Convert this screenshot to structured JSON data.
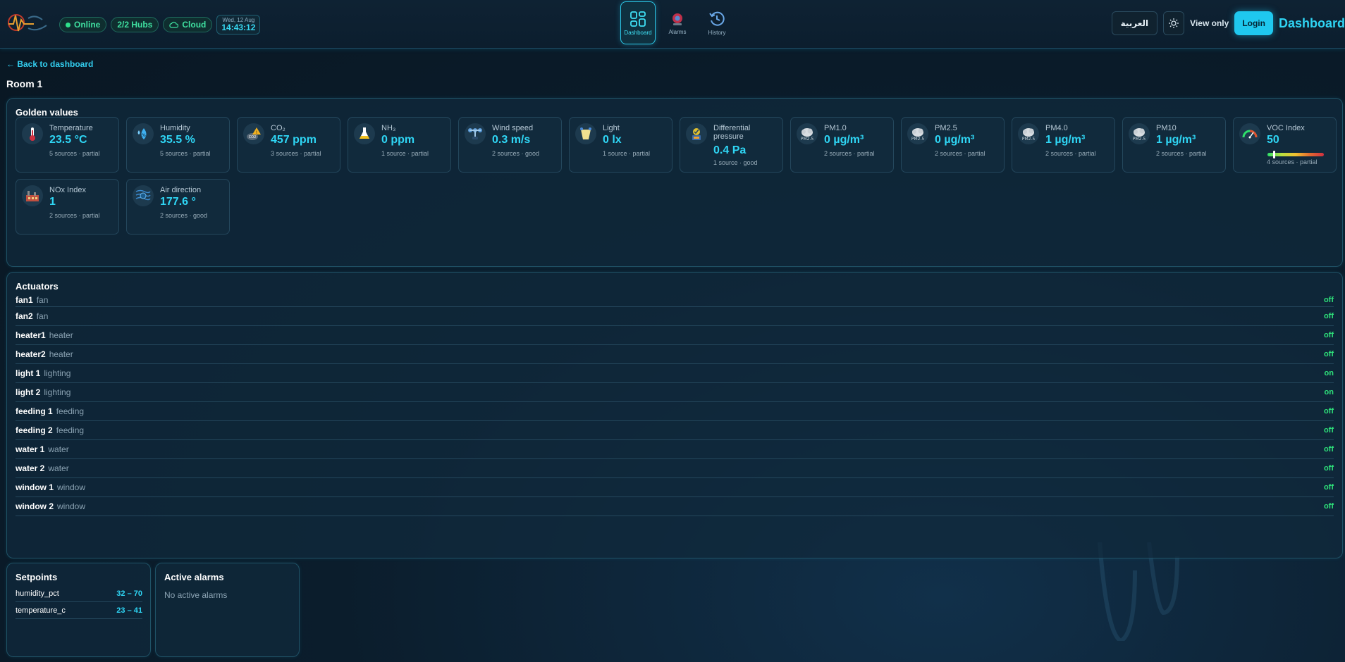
{
  "header": {
    "status": {
      "online": "Online",
      "hubs": "2/2 Hubs",
      "cloud": "Cloud",
      "date": "Wed, 12 Aug",
      "time": "14:43:12"
    },
    "nav": [
      {
        "label": "Dashboard",
        "icon": "dashboard-icon",
        "active": true
      },
      {
        "label": "Alarms",
        "icon": "alarm-bell-icon",
        "active": false
      },
      {
        "label": "History",
        "icon": "history-icon",
        "active": false
      }
    ],
    "language": "العربية",
    "view_only": "View only",
    "login": "Login",
    "title": "Dashboard"
  },
  "page": {
    "back": "← Back to dashboard",
    "room": "Room 1"
  },
  "golden": {
    "title": "Golden values",
    "cards": [
      {
        "label": "Temperature",
        "value": "23.5 °C",
        "sources": "5 sources · partial",
        "icon": "thermometer-icon"
      },
      {
        "label": "Humidity",
        "value": "35.5 %",
        "sources": "5 sources · partial",
        "icon": "humidity-drops-icon"
      },
      {
        "label": "CO₂",
        "value": "457 ppm",
        "sources": "3 sources · partial",
        "icon": "co2-warning-icon"
      },
      {
        "label": "NH₃",
        "value": "0 ppm",
        "sources": "1 source · partial",
        "icon": "nh3-flask-icon"
      },
      {
        "label": "Wind speed",
        "value": "0.3 m/s",
        "sources": "2 sources · good",
        "icon": "wind-speed-icon"
      },
      {
        "label": "Light",
        "value": "0 lx",
        "sources": "1 source · partial",
        "icon": "light-cup-icon"
      },
      {
        "label": "Differential pressure",
        "value": "0.4 Pa",
        "sources": "1 source · good",
        "icon": "pressure-gauge-icon"
      },
      {
        "label": "PM1.0",
        "value": "0 µg/m³",
        "sources": "2 sources · partial",
        "icon": "pm-cloud-icon"
      },
      {
        "label": "PM2.5",
        "value": "0 µg/m³",
        "sources": "2 sources · partial",
        "icon": "pm-cloud-icon"
      },
      {
        "label": "PM4.0",
        "value": "1 µg/m³",
        "sources": "2 sources · partial",
        "icon": "pm-cloud-icon"
      },
      {
        "label": "PM10",
        "value": "1 µg/m³",
        "sources": "2 sources · partial",
        "icon": "pm-cloud-icon"
      },
      {
        "label": "VOC Index",
        "value": "50",
        "sources": "4 sources · partial",
        "icon": "voc-gauge-icon",
        "level": 0.1
      },
      {
        "label": "NOx Index",
        "value": "1",
        "sources": "2 sources · partial",
        "icon": "nox-factory-icon"
      },
      {
        "label": "Air direction",
        "value": "177.6 °",
        "sources": "2 sources · good",
        "icon": "air-direction-icon"
      }
    ]
  },
  "actuators": {
    "title": "Actuators",
    "items": [
      {
        "name": "fan1",
        "type": "fan",
        "state": "off"
      },
      {
        "name": "fan2",
        "type": "fan",
        "state": "off"
      },
      {
        "name": "heater1",
        "type": "heater",
        "state": "off"
      },
      {
        "name": "heater2",
        "type": "heater",
        "state": "off"
      },
      {
        "name": "light 1",
        "type": "lighting",
        "state": "on"
      },
      {
        "name": "light 2",
        "type": "lighting",
        "state": "on"
      },
      {
        "name": "feeding 1",
        "type": "feeding",
        "state": "off"
      },
      {
        "name": "feeding 2",
        "type": "feeding",
        "state": "off"
      },
      {
        "name": "water 1",
        "type": "water",
        "state": "off"
      },
      {
        "name": "water 2",
        "type": "water",
        "state": "off"
      },
      {
        "name": "window 1",
        "type": "window",
        "state": "off"
      },
      {
        "name": "window 2",
        "type": "window",
        "state": "off"
      }
    ]
  },
  "setpoints": {
    "title": "Setpoints",
    "items": [
      {
        "key": "humidity_pct",
        "range": "32 – 70"
      },
      {
        "key": "temperature_c",
        "range": "23 – 41"
      }
    ]
  },
  "alarms": {
    "title": "Active alarms",
    "empty": "No active alarms"
  },
  "colors": {
    "accent": "#2fd6f5",
    "ok_green": "#2ee07a",
    "panel_border": "#1f5266"
  }
}
